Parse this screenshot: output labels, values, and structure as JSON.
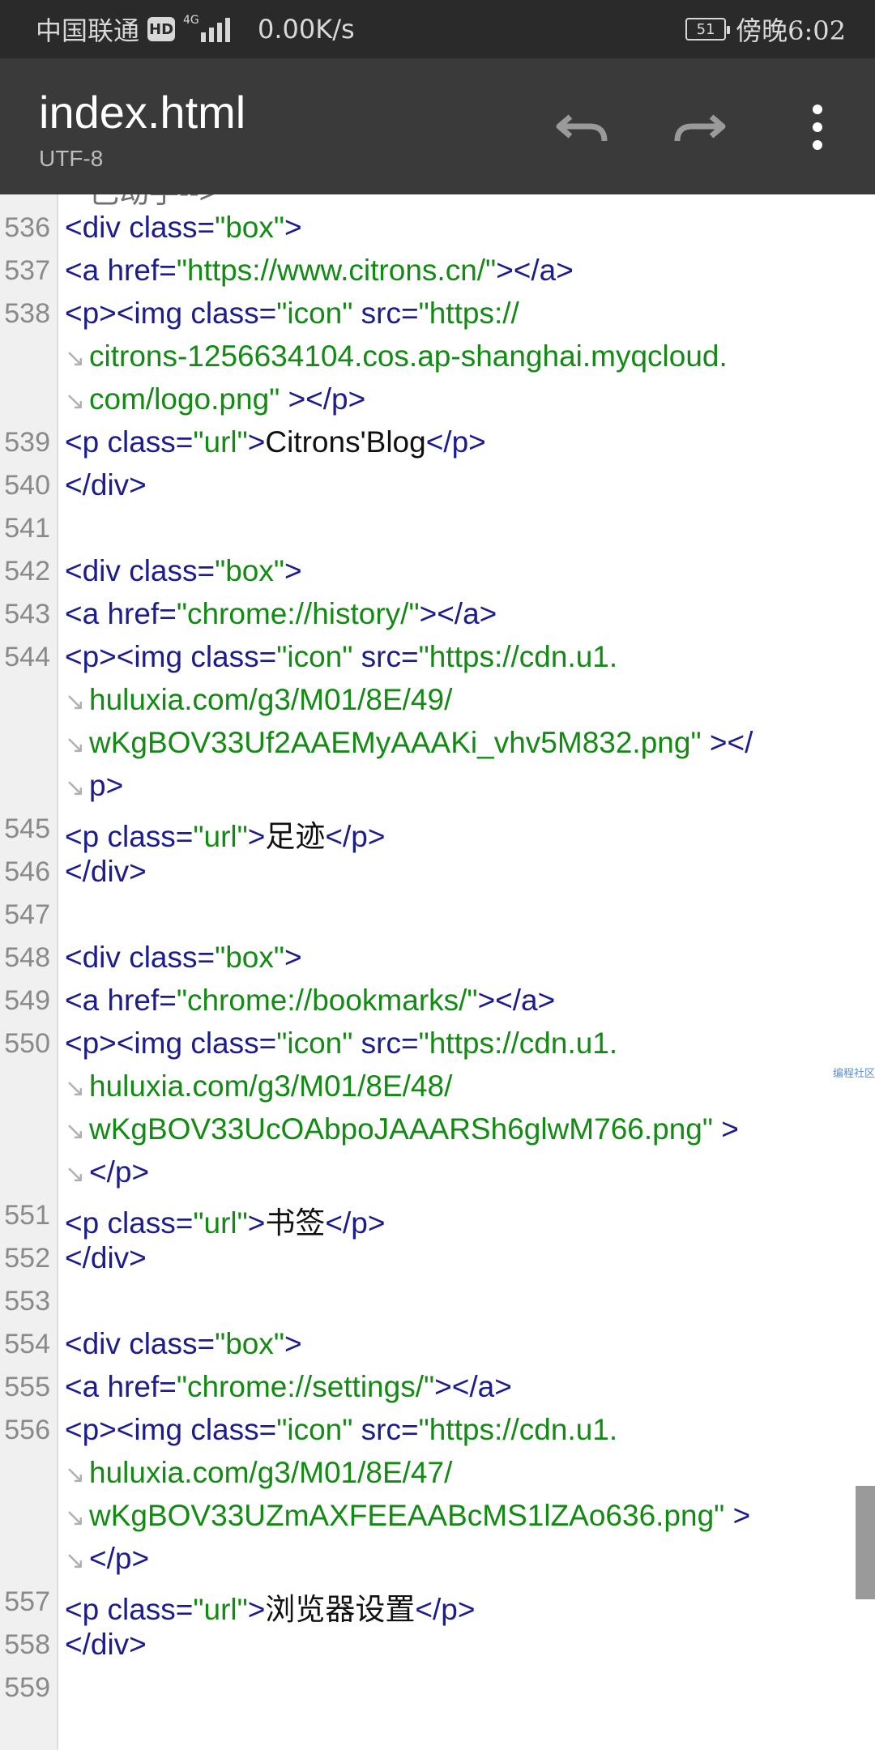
{
  "status_bar": {
    "carrier": "中国联通",
    "hd": "HD",
    "network": "4G",
    "speed": "0.00K/s",
    "battery": "51",
    "time": "傍晚6:02"
  },
  "toolbar": {
    "title": "index.html",
    "encoding": "UTF-8"
  },
  "watermark": "编程社区",
  "lines": [
    {
      "num": "",
      "wrap": true,
      "segs": [
        {
          "t": "己动手-->",
          "c": "cmt"
        }
      ]
    },
    {
      "num": "536",
      "segs": [
        {
          "t": "<div ",
          "c": "tag"
        },
        {
          "t": "class=",
          "c": "attr"
        },
        {
          "t": "\"box\"",
          "c": "str"
        },
        {
          "t": ">",
          "c": "tag"
        }
      ]
    },
    {
      "num": "537",
      "segs": [
        {
          "t": "<a ",
          "c": "tag"
        },
        {
          "t": "href=",
          "c": "attr"
        },
        {
          "t": "\"https://www.citrons.cn/\"",
          "c": "str"
        },
        {
          "t": "></a>",
          "c": "tag"
        }
      ]
    },
    {
      "num": "538",
      "segs": [
        {
          "t": "<p><img ",
          "c": "tag"
        },
        {
          "t": "class=",
          "c": "attr"
        },
        {
          "t": "\"icon\" ",
          "c": "str"
        },
        {
          "t": "src=",
          "c": "attr"
        },
        {
          "t": "\"https://",
          "c": "str"
        }
      ]
    },
    {
      "num": "",
      "wrap": true,
      "segs": [
        {
          "t": "citrons-1256634104.cos.ap-shanghai.myqcloud.",
          "c": "str"
        }
      ]
    },
    {
      "num": "",
      "wrap": true,
      "segs": [
        {
          "t": "com/logo.png\" ",
          "c": "str"
        },
        {
          "t": "></p>",
          "c": "tag"
        }
      ]
    },
    {
      "num": "539",
      "segs": [
        {
          "t": "<p ",
          "c": "tag"
        },
        {
          "t": "class=",
          "c": "attr"
        },
        {
          "t": "\"url\"",
          "c": "str"
        },
        {
          "t": ">",
          "c": "tag"
        },
        {
          "t": "Citrons'Blog",
          "c": "txt"
        },
        {
          "t": "</p>",
          "c": "tag"
        }
      ]
    },
    {
      "num": "540",
      "segs": [
        {
          "t": "</div>",
          "c": "tag"
        }
      ]
    },
    {
      "num": "541",
      "segs": []
    },
    {
      "num": "542",
      "segs": [
        {
          "t": "<div ",
          "c": "tag"
        },
        {
          "t": "class=",
          "c": "attr"
        },
        {
          "t": "\"box\"",
          "c": "str"
        },
        {
          "t": ">",
          "c": "tag"
        }
      ]
    },
    {
      "num": "543",
      "segs": [
        {
          "t": "<a ",
          "c": "tag"
        },
        {
          "t": "href=",
          "c": "attr"
        },
        {
          "t": "\"chrome://history/\"",
          "c": "str"
        },
        {
          "t": "></a>",
          "c": "tag"
        }
      ]
    },
    {
      "num": "544",
      "segs": [
        {
          "t": "<p><img ",
          "c": "tag"
        },
        {
          "t": "class=",
          "c": "attr"
        },
        {
          "t": "\"icon\" ",
          "c": "str"
        },
        {
          "t": "src=",
          "c": "attr"
        },
        {
          "t": "\"https://cdn.u1.",
          "c": "str"
        }
      ]
    },
    {
      "num": "",
      "wrap": true,
      "segs": [
        {
          "t": "huluxia.com/g3/M01/8E/49/",
          "c": "str"
        }
      ]
    },
    {
      "num": "",
      "wrap": true,
      "segs": [
        {
          "t": "wKgBOV33Uf2AAEMyAAAKi_vhv5M832.png\" ",
          "c": "str"
        },
        {
          "t": "></",
          "c": "tag"
        }
      ]
    },
    {
      "num": "",
      "wrap": true,
      "segs": [
        {
          "t": "p>",
          "c": "tag"
        }
      ]
    },
    {
      "num": "545",
      "segs": [
        {
          "t": "<p ",
          "c": "tag"
        },
        {
          "t": "class=",
          "c": "attr"
        },
        {
          "t": "\"url\"",
          "c": "str"
        },
        {
          "t": ">",
          "c": "tag"
        },
        {
          "t": "足迹",
          "c": "txt"
        },
        {
          "t": "</p>",
          "c": "tag"
        }
      ]
    },
    {
      "num": "546",
      "segs": [
        {
          "t": "</div>",
          "c": "tag"
        }
      ]
    },
    {
      "num": "547",
      "segs": []
    },
    {
      "num": "548",
      "segs": [
        {
          "t": "<div ",
          "c": "tag"
        },
        {
          "t": "class=",
          "c": "attr"
        },
        {
          "t": "\"box\"",
          "c": "str"
        },
        {
          "t": ">",
          "c": "tag"
        }
      ]
    },
    {
      "num": "549",
      "segs": [
        {
          "t": "<a ",
          "c": "tag"
        },
        {
          "t": "href=",
          "c": "attr"
        },
        {
          "t": "\"chrome://bookmarks/\"",
          "c": "str"
        },
        {
          "t": "></a>",
          "c": "tag"
        }
      ]
    },
    {
      "num": "550",
      "segs": [
        {
          "t": "<p><img ",
          "c": "tag"
        },
        {
          "t": "class=",
          "c": "attr"
        },
        {
          "t": "\"icon\" ",
          "c": "str"
        },
        {
          "t": "src=",
          "c": "attr"
        },
        {
          "t": "\"https://cdn.u1.",
          "c": "str"
        }
      ]
    },
    {
      "num": "",
      "wrap": true,
      "segs": [
        {
          "t": "huluxia.com/g3/M01/8E/48/",
          "c": "str"
        }
      ]
    },
    {
      "num": "",
      "wrap": true,
      "segs": [
        {
          "t": "wKgBOV33UcOAbpoJAAARSh6glwM766.png\" ",
          "c": "str"
        },
        {
          "t": ">",
          "c": "tag"
        }
      ]
    },
    {
      "num": "",
      "wrap": true,
      "segs": [
        {
          "t": "</p>",
          "c": "tag"
        }
      ]
    },
    {
      "num": "551",
      "segs": [
        {
          "t": "<p ",
          "c": "tag"
        },
        {
          "t": "class=",
          "c": "attr"
        },
        {
          "t": "\"url\"",
          "c": "str"
        },
        {
          "t": ">",
          "c": "tag"
        },
        {
          "t": "书签",
          "c": "txt"
        },
        {
          "t": "</p>",
          "c": "tag"
        }
      ]
    },
    {
      "num": "552",
      "segs": [
        {
          "t": "</div>",
          "c": "tag"
        }
      ]
    },
    {
      "num": "553",
      "segs": []
    },
    {
      "num": "554",
      "segs": [
        {
          "t": "<div ",
          "c": "tag"
        },
        {
          "t": "class=",
          "c": "attr"
        },
        {
          "t": "\"box\"",
          "c": "str"
        },
        {
          "t": ">",
          "c": "tag"
        }
      ]
    },
    {
      "num": "555",
      "segs": [
        {
          "t": "<a ",
          "c": "tag"
        },
        {
          "t": "href=",
          "c": "attr"
        },
        {
          "t": "\"chrome://settings/\"",
          "c": "str"
        },
        {
          "t": "></a>",
          "c": "tag"
        }
      ]
    },
    {
      "num": "556",
      "segs": [
        {
          "t": "<p><img ",
          "c": "tag"
        },
        {
          "t": "class=",
          "c": "attr"
        },
        {
          "t": "\"icon\" ",
          "c": "str"
        },
        {
          "t": "src=",
          "c": "attr"
        },
        {
          "t": "\"https://cdn.u1.",
          "c": "str"
        }
      ]
    },
    {
      "num": "",
      "wrap": true,
      "segs": [
        {
          "t": "huluxia.com/g3/M01/8E/47/",
          "c": "str"
        }
      ]
    },
    {
      "num": "",
      "wrap": true,
      "segs": [
        {
          "t": "wKgBOV33UZmAXFEEAABcMS1lZAo636.png\" ",
          "c": "str"
        },
        {
          "t": ">",
          "c": "tag"
        }
      ]
    },
    {
      "num": "",
      "wrap": true,
      "segs": [
        {
          "t": "</p>",
          "c": "tag"
        }
      ]
    },
    {
      "num": "557",
      "segs": [
        {
          "t": "<p ",
          "c": "tag"
        },
        {
          "t": "class=",
          "c": "attr"
        },
        {
          "t": "\"url\"",
          "c": "str"
        },
        {
          "t": ">",
          "c": "tag"
        },
        {
          "t": "浏览器设置",
          "c": "txt"
        },
        {
          "t": "</p>",
          "c": "tag"
        }
      ]
    },
    {
      "num": "558",
      "segs": [
        {
          "t": "</div>",
          "c": "tag"
        }
      ]
    },
    {
      "num": "559",
      "segs": []
    }
  ]
}
